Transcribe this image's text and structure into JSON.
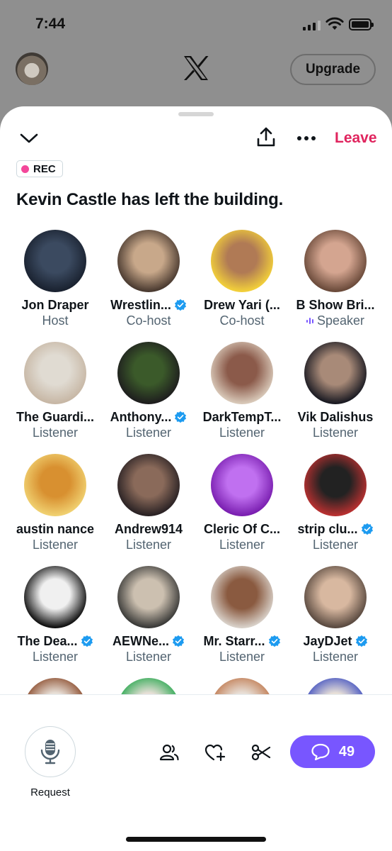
{
  "status_bar": {
    "time": "7:44"
  },
  "top_bar": {
    "upgrade_label": "Upgrade"
  },
  "space": {
    "leave_label": "Leave",
    "rec_label": "REC",
    "title": "Kevin Castle has left the building.",
    "participants": [
      {
        "name": "Jon Draper",
        "role": "Host",
        "verified": false,
        "colors": [
          "#1a2230",
          "#3b4a60"
        ]
      },
      {
        "name": "Wrestlin...",
        "role": "Co-host",
        "verified": true,
        "colors": [
          "#4a3a30",
          "#c8a88a"
        ]
      },
      {
        "name": "Drew Yari (...",
        "role": "Co-host",
        "verified": false,
        "colors": [
          "#f2cf3a",
          "#b07a55"
        ]
      },
      {
        "name": "B Show Bri...",
        "role": "Speaker",
        "verified": false,
        "speaking": true,
        "colors": [
          "#6a4a3a",
          "#d4a590"
        ]
      },
      {
        "name": "The Guardi...",
        "role": "Listener",
        "verified": false,
        "colors": [
          "#c7b7a5",
          "#e0dbd2"
        ]
      },
      {
        "name": "Anthony...",
        "role": "Listener",
        "verified": true,
        "colors": [
          "#1e1e1e",
          "#3b5a2a"
        ]
      },
      {
        "name": "DarkTempT...",
        "role": "Listener",
        "verified": false,
        "colors": [
          "#d8c8b8",
          "#8b5a4a"
        ]
      },
      {
        "name": "Vik Dalishus",
        "role": "Listener",
        "verified": false,
        "colors": [
          "#1a1a22",
          "#a88a78"
        ]
      },
      {
        "name": "austin nance",
        "role": "Listener",
        "verified": false,
        "colors": [
          "#f0d070",
          "#d89030"
        ]
      },
      {
        "name": "Andrew914",
        "role": "Listener",
        "verified": false,
        "colors": [
          "#2a2224",
          "#8a6a5a"
        ]
      },
      {
        "name": "Cleric Of C...",
        "role": "Listener",
        "verified": false,
        "colors": [
          "#7a1fb0",
          "#c070f0"
        ]
      },
      {
        "name": "strip clu...",
        "role": "Listener",
        "verified": true,
        "colors": [
          "#b83030",
          "#222"
        ]
      },
      {
        "name": "The Dea...",
        "role": "Listener",
        "verified": true,
        "colors": [
          "#111",
          "#f0f0f0"
        ]
      },
      {
        "name": "AEWNe...",
        "role": "Listener",
        "verified": true,
        "colors": [
          "#3a3a38",
          "#ccc0b0"
        ]
      },
      {
        "name": "Mr. Starr...",
        "role": "Listener",
        "verified": true,
        "colors": [
          "#d8d0c8",
          "#8a5a40"
        ]
      },
      {
        "name": "JayDJet",
        "role": "Listener",
        "verified": true,
        "colors": [
          "#5a4a40",
          "#d8b8a0"
        ]
      }
    ],
    "partial_row_colors": [
      "#8a4a2a",
      "#2aa850",
      "#c07a50",
      "#4050c0"
    ]
  },
  "controls": {
    "request_label": "Request",
    "comment_count": "49"
  },
  "colors": {
    "accent": "#7856ff",
    "leave": "#e0245e",
    "verified": "#1d9bf0",
    "rec_dot": "#f3479a"
  },
  "icons": [
    "chevron-down-icon",
    "share-icon",
    "more-icon",
    "microphone-icon",
    "people-icon",
    "heart-plus-icon",
    "scissors-icon",
    "comment-icon",
    "x-logo-icon"
  ]
}
